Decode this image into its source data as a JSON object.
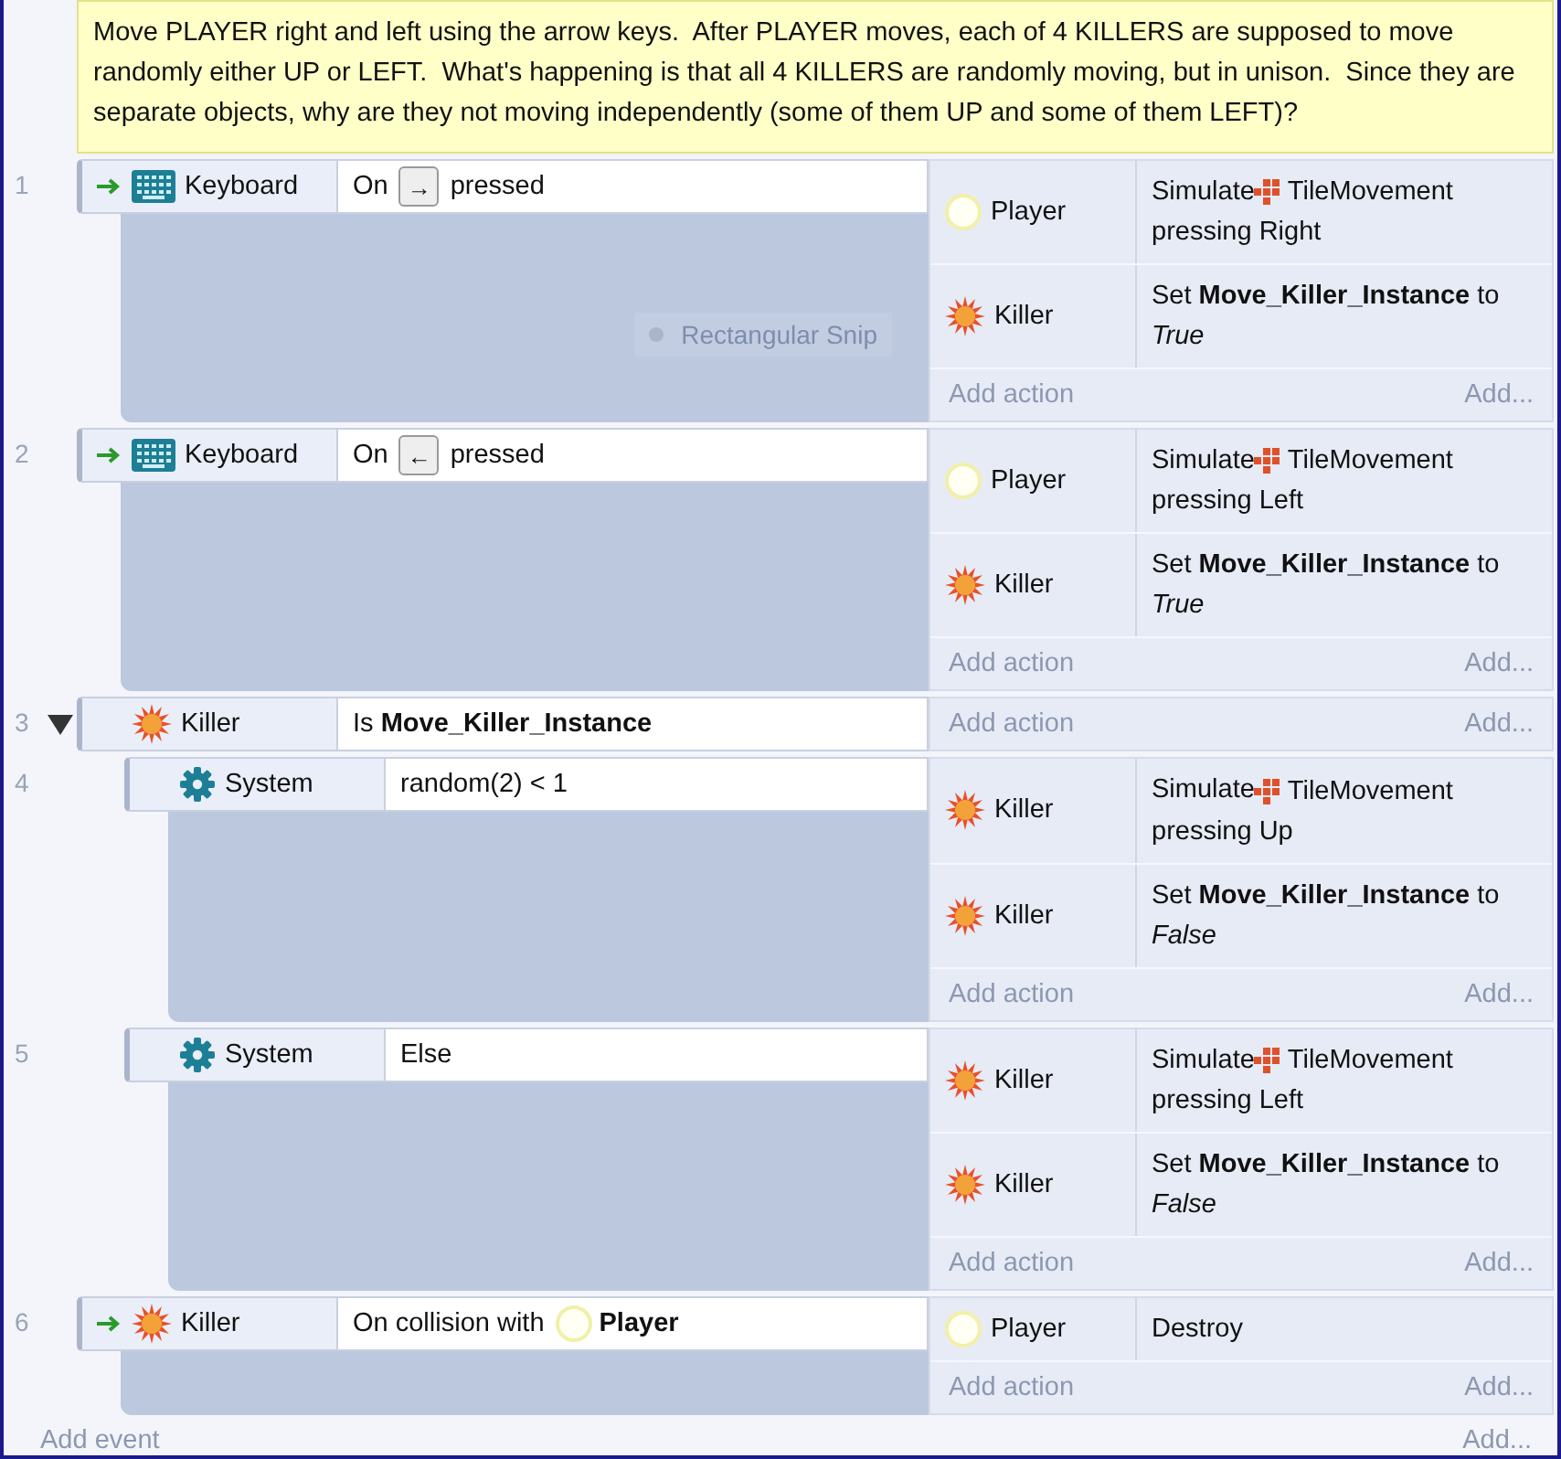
{
  "comment": "Move PLAYER right and left using the arrow keys.  After PLAYER moves, each of 4 KILLERS are supposed to move randomly either UP or LEFT.  What's happening is that all 4 KILLERS are randomly moving, but in unison.  Since they are separate objects, why are they not moving independently (some of them UP and some of them LEFT)?",
  "events": [
    {
      "number": "1",
      "trigger": true,
      "condition": {
        "object": "Keyboard",
        "kind": "keyboard",
        "parts": [
          {
            "kind": "text",
            "text": "On"
          },
          {
            "kind": "key",
            "text": "→"
          },
          {
            "kind": "text",
            "text": "pressed"
          }
        ]
      },
      "overlay": "Rectangular Snip",
      "actions": [
        {
          "object": "Player",
          "kind": "player",
          "parts": [
            {
              "kind": "text",
              "text": "Simulate"
            },
            {
              "kind": "behavior",
              "text": "TileMovement"
            },
            {
              "kind": "text",
              "text": "pressing Right"
            }
          ]
        },
        {
          "object": "Killer",
          "kind": "killer",
          "parts": [
            {
              "kind": "text",
              "text": "Set **Move_Killer_Instance** to *True*"
            }
          ]
        }
      ],
      "add_action": "Add action",
      "add_more": "Add..."
    },
    {
      "number": "2",
      "trigger": true,
      "condition": {
        "object": "Keyboard",
        "kind": "keyboard",
        "parts": [
          {
            "kind": "text",
            "text": "On"
          },
          {
            "kind": "key",
            "text": "←"
          },
          {
            "kind": "text",
            "text": "pressed"
          }
        ]
      },
      "actions": [
        {
          "object": "Player",
          "kind": "player",
          "parts": [
            {
              "kind": "text",
              "text": "Simulate"
            },
            {
              "kind": "behavior",
              "text": "TileMovement"
            },
            {
              "kind": "text",
              "text": "pressing Left"
            }
          ]
        },
        {
          "object": "Killer",
          "kind": "killer",
          "parts": [
            {
              "kind": "text",
              "text": "Set **Move_Killer_Instance** to *True*"
            }
          ]
        }
      ],
      "add_action": "Add action",
      "add_more": "Add..."
    },
    {
      "number": "3",
      "trigger": false,
      "expanded": true,
      "condition": {
        "object": "Killer",
        "kind": "killer",
        "parts": [
          {
            "kind": "text",
            "text": "Is **Move_Killer_Instance**"
          }
        ]
      },
      "add_action": "Add action",
      "add_more": "Add...",
      "children": [
        {
          "number": "4",
          "trigger": false,
          "condition": {
            "object": "System",
            "kind": "system",
            "parts": [
              {
                "kind": "text",
                "text": "random(2) < 1"
              }
            ]
          },
          "actions": [
            {
              "object": "Killer",
              "kind": "killer",
              "parts": [
                {
                  "kind": "text",
                  "text": "Simulate"
                },
                {
                  "kind": "behavior",
                  "text": "TileMovement"
                },
                {
                  "kind": "text",
                  "text": "pressing Up"
                }
              ]
            },
            {
              "object": "Killer",
              "kind": "killer",
              "parts": [
                {
                  "kind": "text",
                  "text": "Set **Move_Killer_Instance** to *False*"
                }
              ]
            }
          ],
          "add_action": "Add action",
          "add_more": "Add..."
        },
        {
          "number": "5",
          "trigger": false,
          "condition": {
            "object": "System",
            "kind": "system",
            "parts": [
              {
                "kind": "text",
                "text": "Else"
              }
            ]
          },
          "actions": [
            {
              "object": "Killer",
              "kind": "killer",
              "parts": [
                {
                  "kind": "text",
                  "text": "Simulate"
                },
                {
                  "kind": "behavior",
                  "text": "TileMovement"
                },
                {
                  "kind": "text",
                  "text": "pressing Left"
                }
              ]
            },
            {
              "object": "Killer",
              "kind": "killer",
              "parts": [
                {
                  "kind": "text",
                  "text": "Set **Move_Killer_Instance** to *False*"
                }
              ]
            }
          ],
          "add_action": "Add action",
          "add_more": "Add..."
        }
      ]
    },
    {
      "number": "6",
      "trigger": true,
      "condition": {
        "object": "Killer",
        "kind": "killer",
        "parts": [
          {
            "kind": "text",
            "text": "On collision with"
          },
          {
            "kind": "player",
            "text": "Player"
          }
        ]
      },
      "actions": [
        {
          "object": "Player",
          "kind": "player",
          "parts": [
            {
              "kind": "text",
              "text": "Destroy"
            }
          ]
        }
      ],
      "add_action": "Add action",
      "add_more": "Add..."
    }
  ],
  "footer": {
    "add_event": "Add event",
    "add_more": "Add..."
  }
}
